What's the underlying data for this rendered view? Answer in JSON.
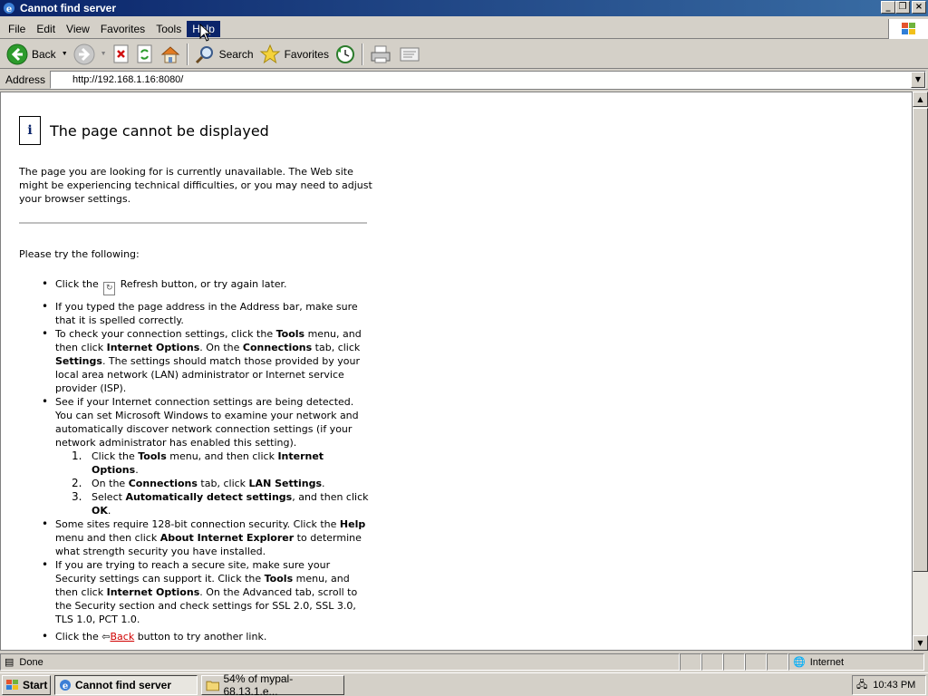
{
  "window": {
    "title": "Cannot find server"
  },
  "menu": [
    "File",
    "Edit",
    "View",
    "Favorites",
    "Tools",
    "Help"
  ],
  "toolbar": {
    "back": "Back",
    "search": "Search",
    "favorites": "Favorites"
  },
  "address": {
    "label": "Address",
    "url": "http://192.168.1.16:8080/"
  },
  "page": {
    "title": "The page cannot be displayed",
    "intro": "The page you are looking for is currently unavailable. The Web site might be experiencing technical difficulties, or you may need to adjust your browser settings.",
    "try": "Please try the following:",
    "b1_a": "Click the ",
    "b1_b": " Refresh button, or try again later.",
    "b2": "If you typed the page address in the Address bar, make sure that it is spelled correctly.",
    "b3_1": "To check your connection settings, click the ",
    "b3_tools": "Tools",
    "b3_2": " menu, and then click ",
    "b3_io": "Internet Options",
    "b3_3": ". On the ",
    "b3_conn": "Connections",
    "b3_4": " tab, click ",
    "b3_settings": "Settings",
    "b3_5": ". The settings should match those provided by your local area network (LAN) administrator or Internet service provider (ISP).",
    "b4": "See if your Internet connection settings are being detected. You can set Microsoft Windows to examine your network and automatically discover network connection settings (if your network administrator has enabled this setting).",
    "s1_1": "Click the ",
    "s1_tools": "Tools",
    "s1_2": " menu, and then click ",
    "s1_io": "Internet Options",
    "s1_3": ".",
    "s2_1": "On the ",
    "s2_conn": "Connections",
    "s2_2": " tab, click ",
    "s2_lan": "LAN Settings",
    "s2_3": ".",
    "s3_1": "Select ",
    "s3_auto": "Automatically detect settings",
    "s3_2": ", and then click ",
    "s3_ok": "OK",
    "s3_3": ".",
    "b5_1": "Some sites require 128-bit connection security. Click the ",
    "b5_help": "Help",
    "b5_2": " menu and then click ",
    "b5_about": "About Internet Explorer",
    "b5_3": " to determine what strength security you have installed.",
    "b6_1": "If you are trying to reach a secure site, make sure your Security settings can support it. Click the ",
    "b6_tools": "Tools",
    "b6_2": " menu, and then click ",
    "b6_io": "Internet Options",
    "b6_3": ". On the Advanced tab, scroll to the Security section and check settings for SSL 2.0, SSL 3.0, TLS 1.0, PCT 1.0.",
    "b7_1": "Click the ",
    "b7_back": "Back",
    "b7_2": " button to try another link."
  },
  "status": {
    "text": "Done",
    "zone": "Internet"
  },
  "taskbar": {
    "start": "Start",
    "tasks": [
      "Cannot find server",
      "54% of mypal-68.13.1.e..."
    ],
    "clock": "10:43 PM"
  }
}
